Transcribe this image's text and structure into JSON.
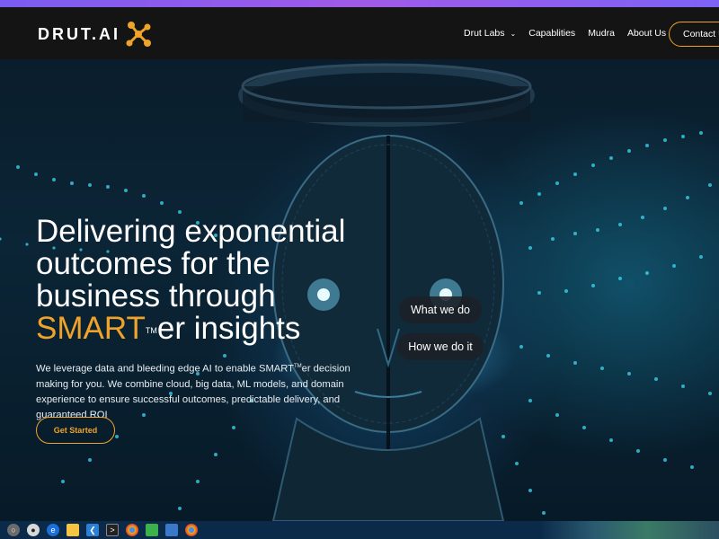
{
  "colors": {
    "accent": "#f0a32a",
    "nav_bg": "#141414",
    "top_stripe": "#9a5bef"
  },
  "brand": {
    "logo_text": "DRUT.AI"
  },
  "nav": {
    "items": [
      {
        "label": "Drut Labs",
        "has_dropdown": true
      },
      {
        "label": "Capablities"
      },
      {
        "label": "Mudra"
      },
      {
        "label": "About Us"
      }
    ],
    "contact_label": "Contact Us"
  },
  "hero": {
    "headline_line1": "Delivering exponential",
    "headline_line2": "outcomes for the",
    "headline_line3": "business through",
    "headline_accent": "SMART",
    "headline_tm": "TM",
    "headline_rest": "er insights",
    "sub_part1": "We leverage data and bleeding edge AI to enable SMART",
    "sub_tm": "TM",
    "sub_part2": "er decision making for you. We combine cloud, big data, ML models, and domain experience to ensure successful outcomes, predictable delivery, and guaranteed ROI",
    "cta_label": "Get Started",
    "pill_1": "What we do",
    "pill_2": "How we do it"
  },
  "taskbar": {
    "icons": [
      "start-icon",
      "chat-icon",
      "edge-icon",
      "file-explorer-icon",
      "vscode-icon",
      "terminal-icon",
      "chrome-icon",
      "nvidia-icon",
      "store-icon",
      "chrome-icon"
    ]
  }
}
